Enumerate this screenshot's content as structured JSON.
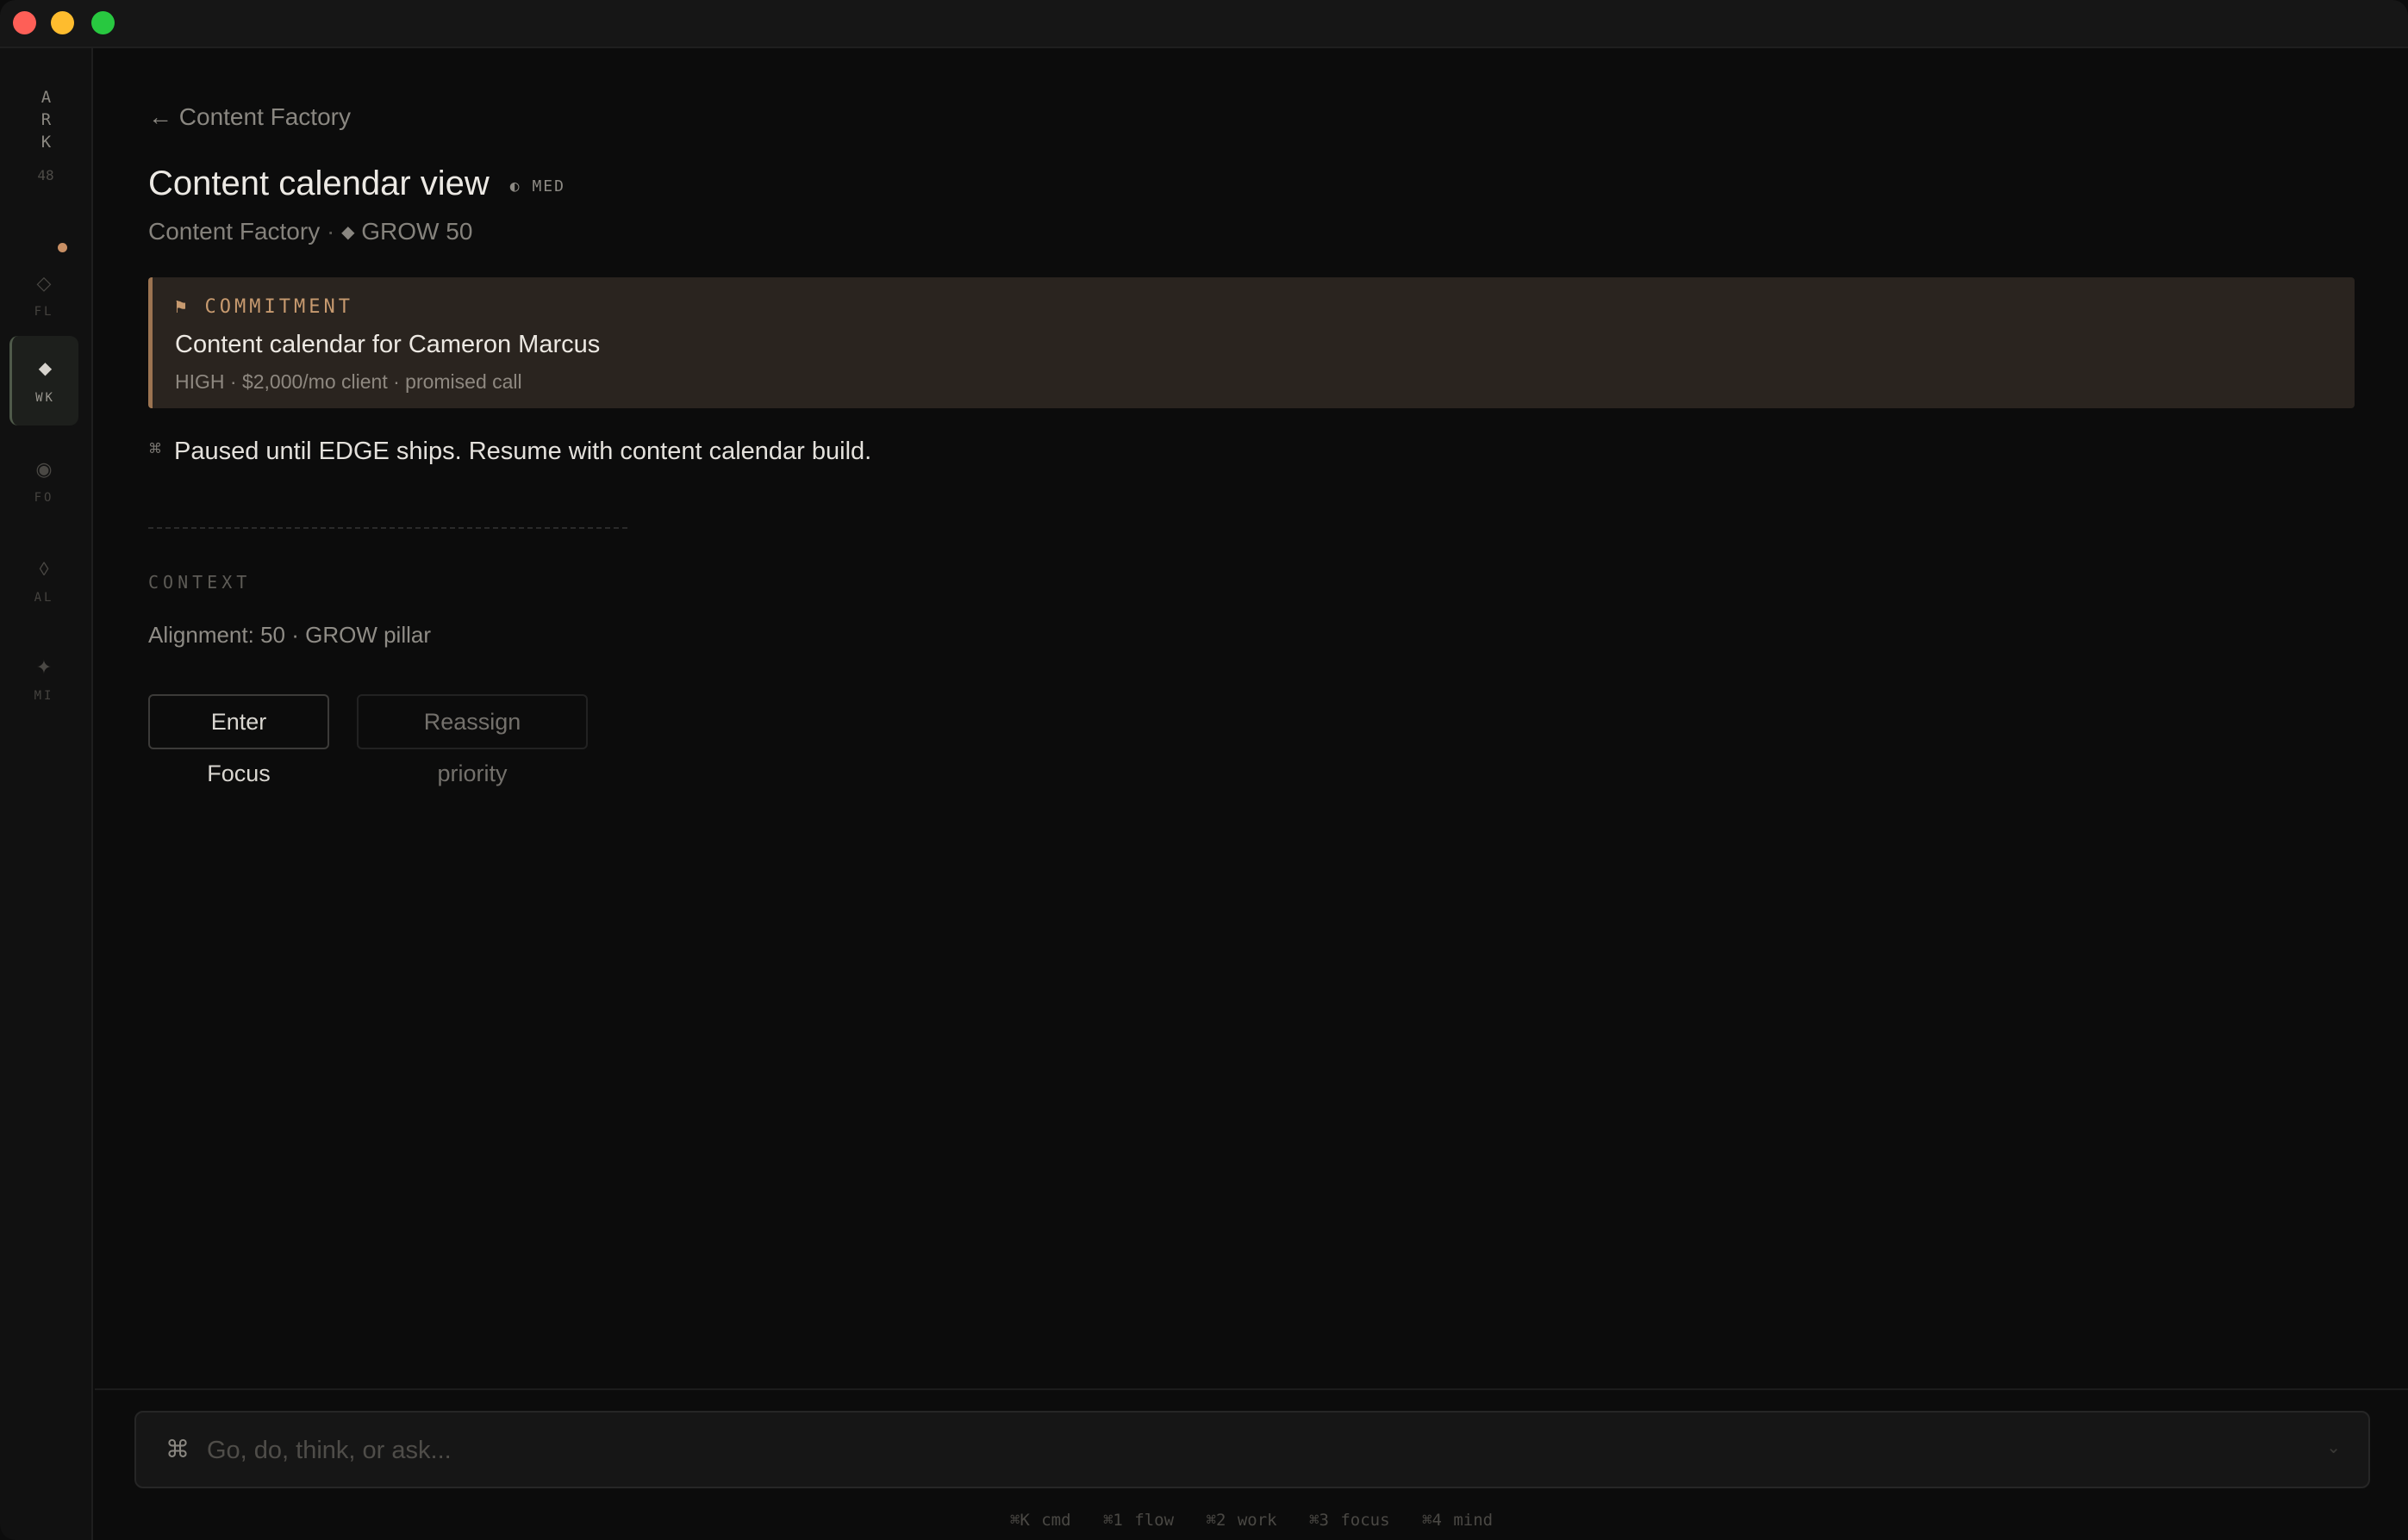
{
  "brand": {
    "name": "ARK",
    "count": "48"
  },
  "nav": {
    "items": [
      {
        "glyph": "◇",
        "label": "FL",
        "icon": "flow-diamond-outline-icon"
      },
      {
        "glyph": "◆",
        "label": "WK",
        "icon": "work-diamond-filled-icon"
      },
      {
        "glyph": "◉",
        "label": "FO",
        "icon": "focus-target-icon"
      },
      {
        "glyph": "◊",
        "label": "AL",
        "icon": "align-lozenge-icon"
      },
      {
        "glyph": "✦",
        "label": "MI",
        "icon": "mind-star-icon"
      }
    ]
  },
  "main": {
    "back_label": "← Content Factory",
    "title": "Content calendar view",
    "priority_glyph": "◐",
    "priority": "MED",
    "subline_project": "Content Factory",
    "subline_sep": "·",
    "subline_diamond": "◆",
    "subline_goal": "GROW 50",
    "commitment": {
      "tag": "⚑ COMMITMENT",
      "title": "Content calendar for Cameron Marcus",
      "meta": "HIGH · $2,000/mo client · promised call"
    },
    "note_icon": "⌘",
    "note": "Paused until EDGE ships. Resume with content calendar build.",
    "context_label": "CONTEXT",
    "context_text": "Alignment: 50 · GROW pillar",
    "buttons": {
      "enter_focus": "Enter Focus",
      "reassign": "Reassign priority"
    }
  },
  "command_bar": {
    "icon": "⌘",
    "placeholder": "Go, do, think, or ask...",
    "caret": "⌄"
  },
  "shortcuts": [
    "⌘K cmd",
    "⌘1 flow",
    "⌘2 work",
    "⌘3 focus",
    "⌘4 mind"
  ],
  "colors": {
    "accent": "#c79a6f",
    "commitment_bg": "#2a241f",
    "notification_dot": "#c88f64"
  }
}
